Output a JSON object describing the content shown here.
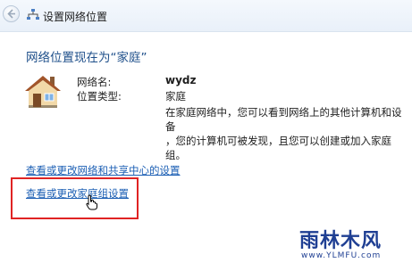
{
  "window": {
    "title": "设置网络位置"
  },
  "main": {
    "heading": "网络位置现在为“家庭”",
    "network_name_label": "网络名:",
    "network_name_value": "wydz",
    "location_type_label": "位置类型:",
    "location_type_value": "家庭",
    "description_line1": "在家庭网络中，您可以看到网络上的其他计算机和设备",
    "description_line2": "，您的计算机可被发现，且您可以创建或加入家庭组。"
  },
  "links": {
    "network_sharing_center": "查看或更改网络和共享中心的设置",
    "homegroup_settings": "查看或更改家庭组设置"
  },
  "watermark": {
    "logo_text": "雨林木风",
    "url_text": "www.YLMFU.com"
  },
  "colors": {
    "heading": "#1e4f8a",
    "link": "#1c5fb4",
    "highlight": "#e02323",
    "watermark": "#1f3f93"
  }
}
